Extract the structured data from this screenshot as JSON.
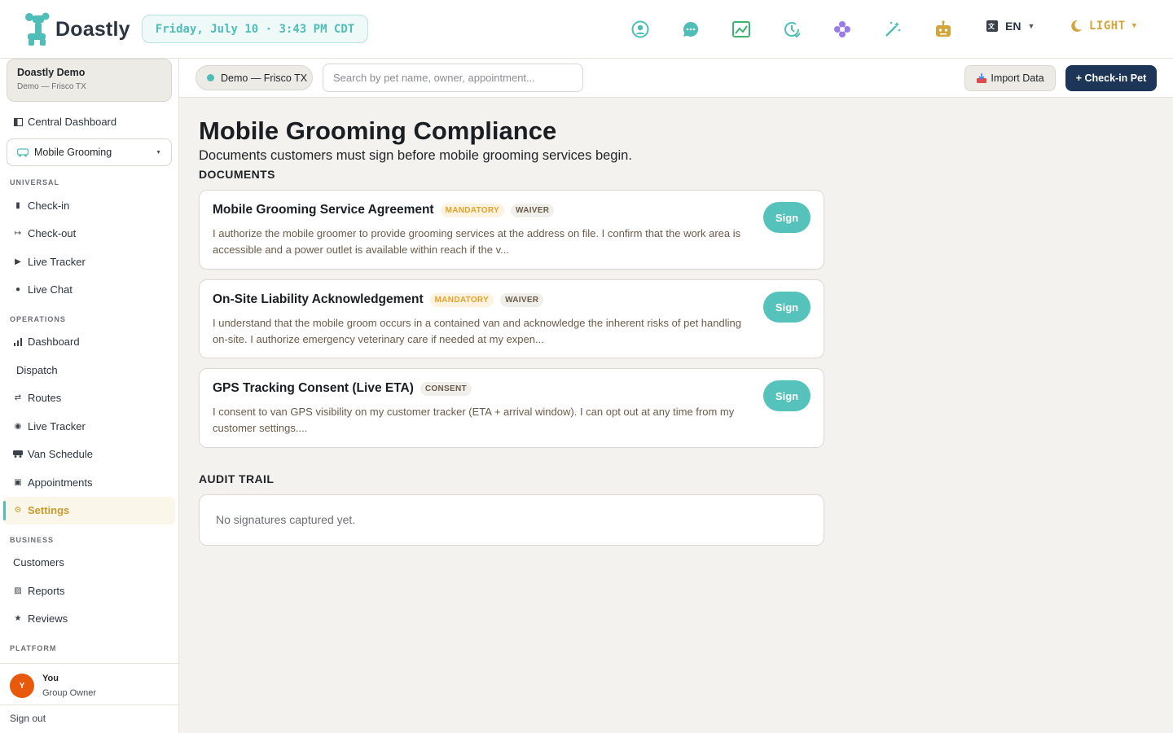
{
  "app": {
    "name": "Doastly"
  },
  "header": {
    "datetime": "Friday, July 10 · 3:43 PM CDT",
    "icons": [
      "profile-icon",
      "chat-icon",
      "growth-chart-icon",
      "schedule-clock-icon",
      "flower-icon",
      "magic-wand-icon",
      "robot-icon"
    ],
    "language": "EN",
    "theme": "LIGHT"
  },
  "sidebar": {
    "org": {
      "name": "Doastly Demo",
      "location": "Demo — Frisco TX"
    },
    "central_dashboard": "Central Dashboard",
    "module_select": "Mobile Grooming",
    "sections": {
      "universal": "UNIVERSAL",
      "operations": "OPERATIONS",
      "business": "BUSINESS",
      "platform": "PLATFORM"
    },
    "universal_items": [
      "Check-in",
      "Check-out",
      "Live Tracker",
      "Live Chat"
    ],
    "operations_items": [
      "Dashboard",
      "Dispatch",
      "Routes",
      "Live Tracker",
      "Van Schedule",
      "Appointments",
      "Settings"
    ],
    "business_items": [
      "Customers",
      "Reports",
      "Reviews"
    ],
    "user": {
      "initial": "Y",
      "name": "You",
      "role": "Group Owner"
    },
    "sign_out": "Sign out"
  },
  "subbar": {
    "location": "Demo — Frisco TX",
    "search_placeholder": "Search by pet name, owner, appointment...",
    "import_label": "Import Data",
    "checkin_label": "+ Check-in Pet"
  },
  "main": {
    "title": "Mobile Grooming Compliance",
    "subtitle": "Documents customers must sign before mobile grooming services begin.",
    "documents_heading": "DOCUMENTS",
    "documents": [
      {
        "title": "Mobile Grooming Service Agreement",
        "badges": [
          "MANDATORY",
          "WAIVER"
        ],
        "body": "I authorize the mobile groomer to provide grooming services at the address on file. I confirm that the work area is accessible and a power outlet is available within reach if the v...",
        "action": "Sign"
      },
      {
        "title": "On-Site Liability Acknowledgement",
        "badges": [
          "MANDATORY",
          "WAIVER"
        ],
        "body": "I understand that the mobile groom occurs in a contained van and acknowledge the inherent risks of pet handling on-site. I authorize emergency veterinary care if needed at my expen...",
        "action": "Sign"
      },
      {
        "title": "GPS Tracking Consent (Live ETA)",
        "badges": [
          "CONSENT"
        ],
        "body": "I consent to van GPS visibility on my customer tracker (ETA + arrival window). I can opt out at any time from my customer settings....",
        "action": "Sign"
      }
    ],
    "audit_heading": "AUDIT TRAIL",
    "audit_empty": "No signatures captured yet."
  },
  "colors": {
    "accent": "#4fbdb8",
    "primary_button": "#1d3557",
    "mandatory_badge": "#e5a22a",
    "active_nav": "#c79a2e",
    "avatar": "#e8590c"
  }
}
